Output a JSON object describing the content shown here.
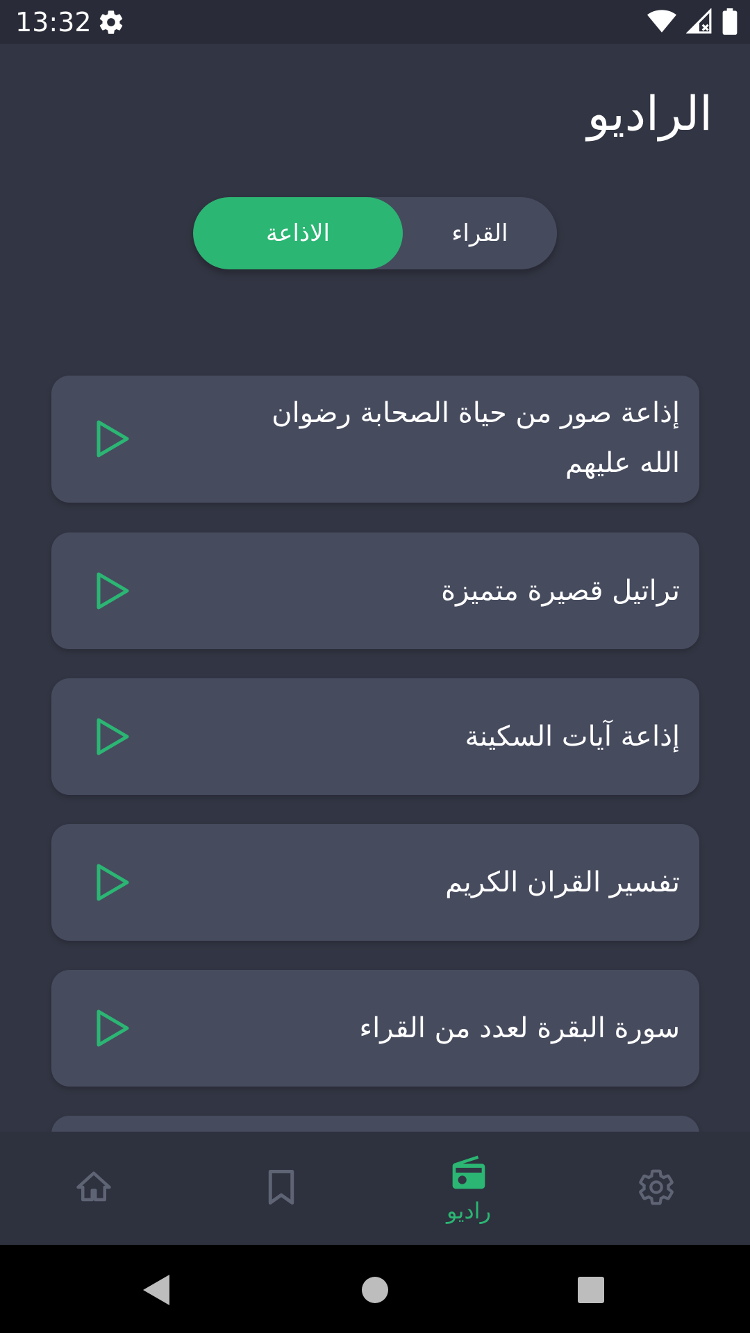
{
  "status_bar": {
    "time": "13:32"
  },
  "header": {
    "title": "الراديو"
  },
  "segment": {
    "radio_label": "الاذاعة",
    "readers_label": "القراء",
    "selected": "radio"
  },
  "stations": [
    {
      "name": "إذاعة صور من حياة الصحابة رضوان الله عليهم"
    },
    {
      "name": "تراتيل قصيرة متميزة"
    },
    {
      "name": "إذاعة آيات السكينة"
    },
    {
      "name": "تفسير القران الكريم"
    },
    {
      "name": "سورة البقرة  لعدد من القراء"
    }
  ],
  "bottom_nav": {
    "radio_label": "راديو",
    "active": "radio"
  },
  "colors": {
    "background": "#323543",
    "card": "#464b5e",
    "accent": "#2bb673",
    "inactive_icon": "#5f6475"
  },
  "icons": {
    "status_settings": "gear-icon",
    "wifi": "wifi-icon",
    "signal": "cellular-signal-icon",
    "battery": "battery-icon",
    "play": "play-icon",
    "home": "home-icon",
    "bookmark": "bookmark-icon",
    "radio": "radio-icon",
    "settings": "gear-icon"
  }
}
